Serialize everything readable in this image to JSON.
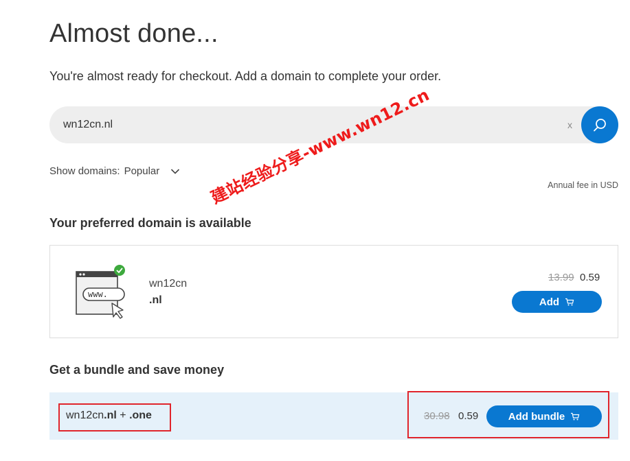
{
  "page": {
    "title": "Almost done...",
    "subtitle": "You're almost ready for checkout. Add a domain to complete your order."
  },
  "search": {
    "value": "wn12cn.nl",
    "clear_label": "x",
    "icon": "search-icon"
  },
  "filter": {
    "label": "Show domains:",
    "selected": "Popular",
    "icon": "chevron-down-icon"
  },
  "fee_note": "Annual fee in USD",
  "watermark": "建站经验分享-www.wn12.cn",
  "preferred": {
    "heading": "Your preferred domain is available",
    "domain_name": "wn12cn",
    "tld": ".nl",
    "www_text": "www.",
    "old_price": "13.99",
    "price": "0.59",
    "button_label": "Add",
    "button_icon": "cart-icon"
  },
  "bundle": {
    "heading": "Get a bundle and save money",
    "name_part": "wn12cn",
    "tld1": ".nl",
    "plus": " + ",
    "tld2": ".one",
    "old_price": "30.98",
    "price": "0.59",
    "button_label": "Add bundle",
    "button_icon": "cart-icon"
  },
  "colors": {
    "accent": "#0a78d1",
    "check_green": "#3da93d",
    "annotation_red": "#e0242b",
    "bundle_bg": "#e5f1fa"
  }
}
